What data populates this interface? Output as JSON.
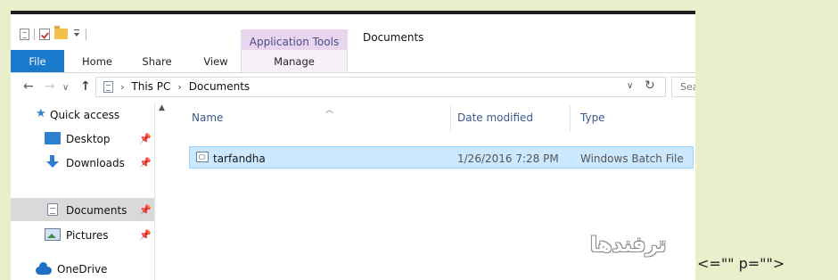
{
  "titlebar": {
    "context_label": "Application Tools",
    "window_title": "Documents"
  },
  "ribbon": {
    "tabs": [
      {
        "label": "File"
      },
      {
        "label": "Home"
      },
      {
        "label": "Share"
      },
      {
        "label": "View"
      },
      {
        "label": "Manage"
      }
    ]
  },
  "address": {
    "crumbs": [
      "This PC",
      "Documents"
    ],
    "search_placeholder": "Search Documents"
  },
  "sidebar": {
    "items": [
      {
        "label": "Quick access",
        "icon": "star-icon",
        "pinned": false
      },
      {
        "label": "Desktop",
        "icon": "desktop-icon",
        "pinned": true
      },
      {
        "label": "Downloads",
        "icon": "download-icon",
        "pinned": true
      },
      {
        "label": "Documents",
        "icon": "documents-icon",
        "pinned": true,
        "selected": true
      },
      {
        "label": "Pictures",
        "icon": "pictures-icon",
        "pinned": true
      },
      {
        "label": "OneDrive",
        "icon": "onedrive-icon",
        "pinned": false
      }
    ],
    "pin_glyph": "📌"
  },
  "filelist": {
    "columns": {
      "name": "Name",
      "date": "Date modified",
      "type": "Type"
    },
    "rows": [
      {
        "name": "tarfandha",
        "date": "1/26/2016 7:28 PM",
        "type": "Windows Batch File",
        "selected": true
      }
    ]
  },
  "overlay": {
    "watermark": "ترفندها",
    "artifact_text": "<=\"\" p=\"\">"
  },
  "colors": {
    "background": "#e9efcb",
    "file_tab": "#1979ca",
    "context_tab": "#e9d6ee",
    "selection": "#cce8ff"
  }
}
